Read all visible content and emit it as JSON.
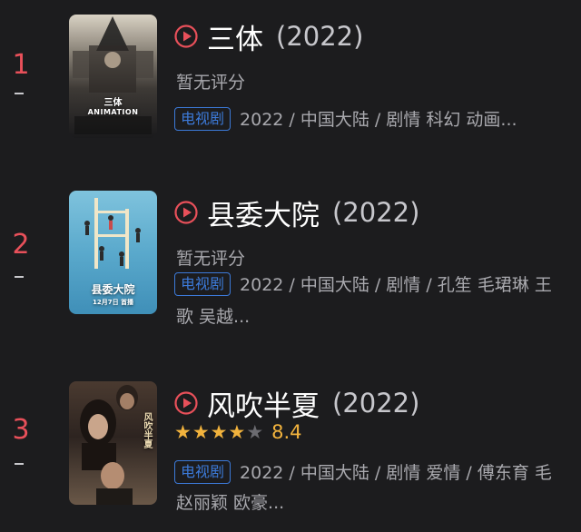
{
  "colors": {
    "background": "#1c1c1e",
    "rank": "#e8505a",
    "play_icon": "#e8505a",
    "badge": "#3c7ad9",
    "star_filled": "#f2b33d",
    "star_empty": "#6b6b70",
    "muted_text": "#a9a9ae"
  },
  "items": [
    {
      "rank": "1",
      "trend_icon": "dash-icon",
      "title": "三体",
      "year": "(2022)",
      "rating_text": "暂无评分",
      "badge": "电视剧",
      "meta": "2022 / 中国大陆 / 剧情 科幻 动画...",
      "meta2": "",
      "poster_text": "三体",
      "poster_subtext": "ANIMATION"
    },
    {
      "rank": "2",
      "trend_icon": "dash-icon",
      "title": "县委大院",
      "year": "(2022)",
      "rating_text": "暂无评分",
      "badge": "电视剧",
      "meta": "2022 / 中国大陆 / 剧情 / 孔笙 毛珺琳 王",
      "meta2": "歌 吴越...",
      "poster_text": "县委大院",
      "poster_subtext": "12月7日 首播"
    },
    {
      "rank": "3",
      "trend_icon": "dash-icon",
      "title": "风吹半夏",
      "year": "(2022)",
      "rating_value": 4,
      "rating_max": 5,
      "score": "8.4",
      "badge": "电视剧",
      "meta": "2022 / 中国大陆 / 剧情 爱情 / 傅东育 毛",
      "meta2": "赵丽颖 欧豪...",
      "poster_text": "风吹半夏"
    }
  ]
}
